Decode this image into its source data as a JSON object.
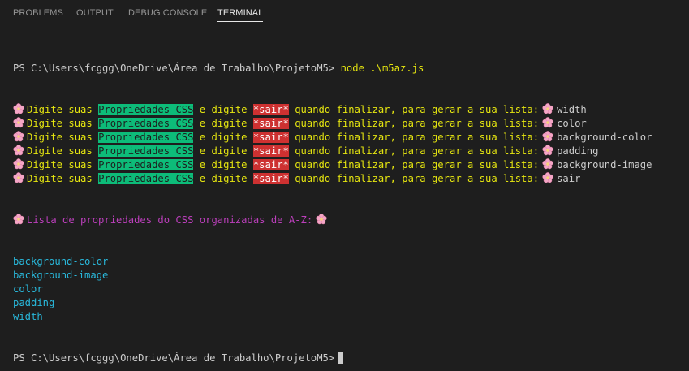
{
  "tabs": [
    {
      "label": "PROBLEMS",
      "active": false
    },
    {
      "label": "OUTPUT",
      "active": false
    },
    {
      "label": "DEBUG CONSOLE",
      "active": false
    },
    {
      "label": "TERMINAL",
      "active": true
    }
  ],
  "terminal": {
    "prompt": "PS C:\\Users\\fcggg\\OneDrive\\Área de Trabalho\\ProjetoM5>",
    "command": "node .\\m5az.js",
    "question": {
      "part1": "Digite suas ",
      "highlight_green": "Propriedades CSS",
      "part2": " e digite ",
      "highlight_red": "*sair*",
      "part3": " quando finalizar, para gerar a sua lista:"
    },
    "inputs": [
      "width",
      "color",
      "background-color",
      "padding",
      "background-image",
      "sair"
    ],
    "result_header": "Lista de propriedades do CSS organizadas de A-Z:",
    "sorted": [
      "background-color",
      "background-image",
      "color",
      "padding",
      "width"
    ],
    "icon": "cherry-blossom-icon",
    "colors": {
      "background": "#1e1e1e",
      "yellow": "#e5e510",
      "green": "#0dbc79",
      "red": "#cd3131",
      "magenta": "#bc3fbc",
      "blue": "#29b8db"
    }
  }
}
